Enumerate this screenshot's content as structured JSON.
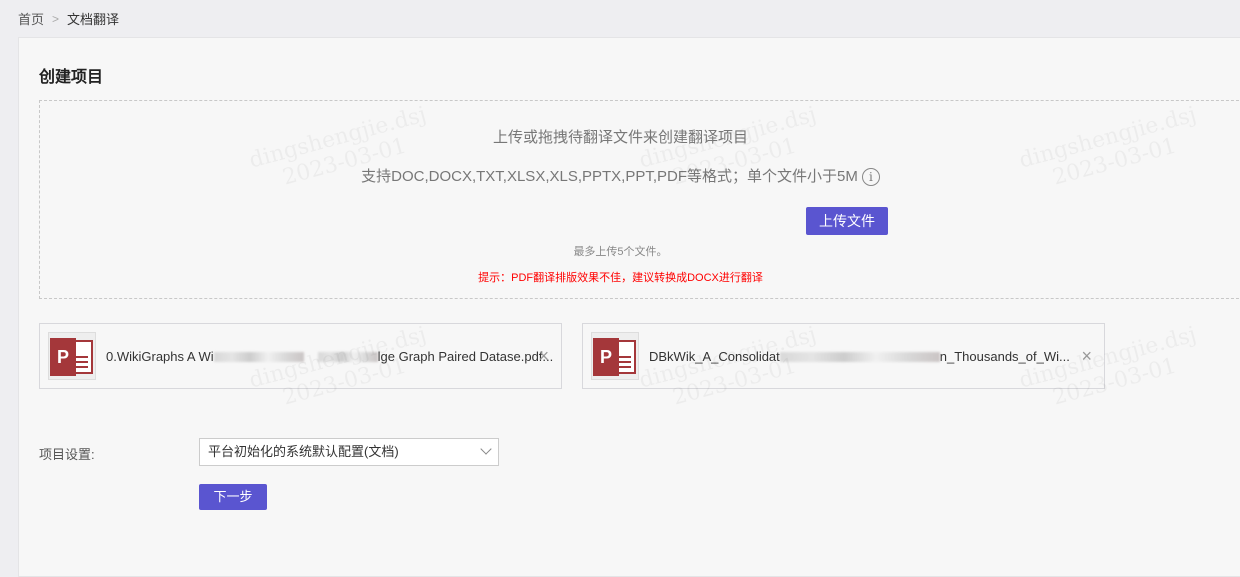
{
  "breadcrumb": {
    "home": "首页",
    "current": "文档翻译"
  },
  "page_title": "创建项目",
  "upload": {
    "heading": "上传或拖拽待翻译文件来创建翻译项目",
    "formats": "支持DOC,DOCX,TXT,XLSX,XLS,PPTX,PPT,PDF等格式；单个文件小于5M",
    "button": "上传文件",
    "limit": "最多上传5个文件。",
    "tip": "提示：PDF翻译排版效果不佳，建议转换成DOCX进行翻译"
  },
  "files": [
    {
      "name_start": "0.WikiGraphs A Wi",
      "name_end": "lge Graph Paired Datase.pdf...",
      "icon": "pdf-file-icon"
    },
    {
      "name_start": "DBkWik_A_Consolidat",
      "name_end": "n_Thousands_of_Wi...",
      "icon": "pdf-file-icon"
    }
  ],
  "settings": {
    "label": "项目设置:",
    "selected": "平台初始化的系统默认配置(文档)"
  },
  "next_button": "下一步",
  "watermark": "dingshengjie.dsj 2023-03-01",
  "colors": {
    "accent": "#5a55d0",
    "tip": "#ff0000"
  }
}
